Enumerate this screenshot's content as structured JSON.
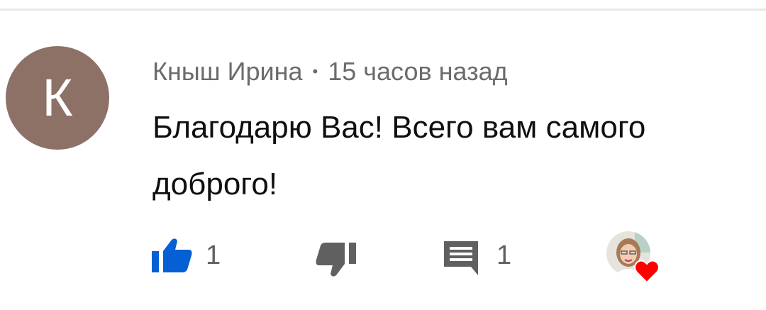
{
  "comment": {
    "avatar_letter": "К",
    "author": "Кныш Ирина",
    "separator": "•",
    "timestamp": "15 часов назад",
    "text": "Благодарю Вас! Всего вам самого доброго!"
  },
  "actions": {
    "like_count": "1",
    "reply_count": "1",
    "like_icon": "thumbs-up-icon",
    "dislike_icon": "thumbs-down-icon",
    "reply_icon": "comment-icon",
    "creator_heart_icon": "heart-icon"
  },
  "colors": {
    "avatar_bg": "#8d7167",
    "like_active": "#065fd4",
    "icon_gray": "#606060",
    "meta_text": "#6b6b6b",
    "heart": "#ff0000"
  }
}
